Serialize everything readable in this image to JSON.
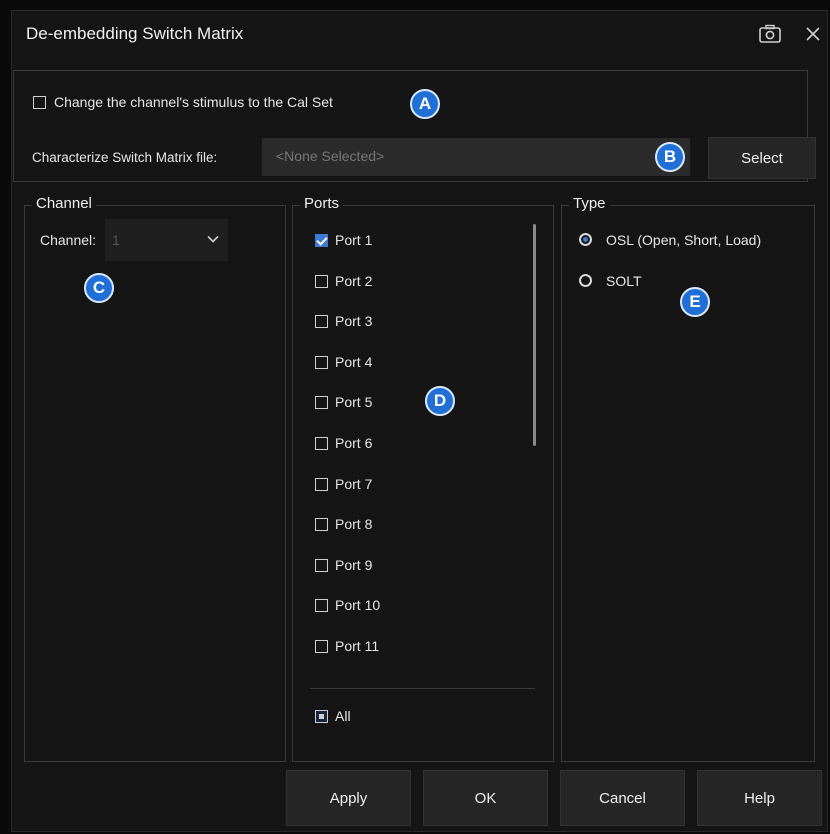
{
  "window": {
    "title": "De-embedding Switch Matrix"
  },
  "calset": {
    "checkbox_label": "Change the channel's stimulus to the Cal Set",
    "checked": false
  },
  "file": {
    "label": "Characterize Switch Matrix file:",
    "placeholder": "<None Selected>",
    "select_label": "Select"
  },
  "channel": {
    "group_title": "Channel",
    "label": "Channel:",
    "value": "1"
  },
  "ports": {
    "group_title": "Ports",
    "items": [
      {
        "label": "Port 1",
        "checked": true
      },
      {
        "label": "Port 2",
        "checked": false
      },
      {
        "label": "Port 3",
        "checked": false
      },
      {
        "label": "Port 4",
        "checked": false
      },
      {
        "label": "Port 5",
        "checked": false
      },
      {
        "label": "Port 6",
        "checked": false
      },
      {
        "label": "Port 7",
        "checked": false
      },
      {
        "label": "Port 8",
        "checked": false
      },
      {
        "label": "Port 9",
        "checked": false
      },
      {
        "label": "Port 10",
        "checked": false
      },
      {
        "label": "Port 11",
        "checked": false
      }
    ],
    "all_label": "All",
    "all_state": "partial"
  },
  "type": {
    "group_title": "Type",
    "options": [
      {
        "label": "OSL (Open, Short, Load)",
        "selected": true
      },
      {
        "label": "SOLT",
        "selected": false
      }
    ]
  },
  "callouts": [
    "A",
    "B",
    "C",
    "D",
    "E"
  ],
  "buttons": {
    "apply": "Apply",
    "ok": "OK",
    "cancel": "Cancel",
    "help": "Help"
  },
  "colors": {
    "accent": "#3c7ad6",
    "callout": "#1f6fd6",
    "background": "#151515"
  }
}
